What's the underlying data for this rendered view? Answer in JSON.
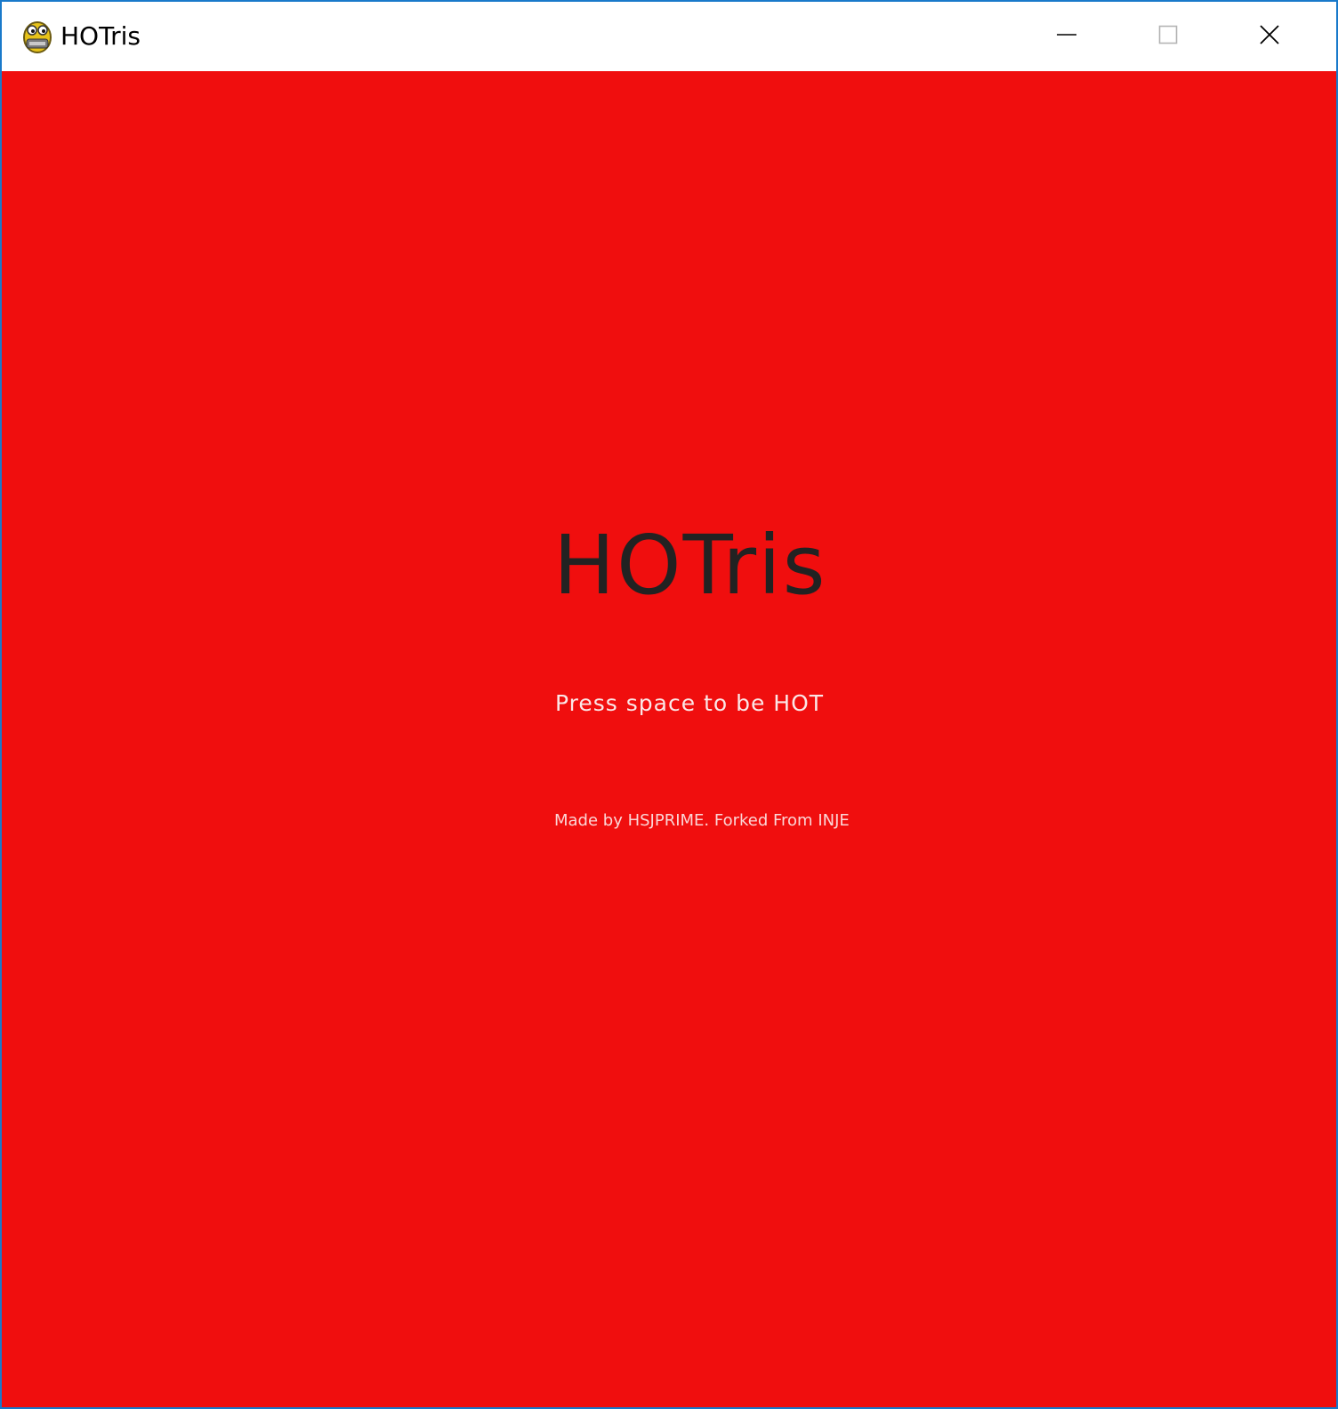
{
  "window": {
    "title": "HOTris",
    "app_icon": "pygame-snake-icon",
    "controls": {
      "minimize_icon": "minimize-icon",
      "maximize_icon": "maximize-icon",
      "close_icon": "close-icon"
    },
    "frame_color": "#1979ca"
  },
  "game": {
    "background_color": "#f00e0e",
    "title": "HOTris",
    "title_color": "#222222",
    "prompt": "Press space to be HOT",
    "credits": "Made by HSJPRIME. Forked From INJE",
    "text_color": "#fbe7e7"
  }
}
